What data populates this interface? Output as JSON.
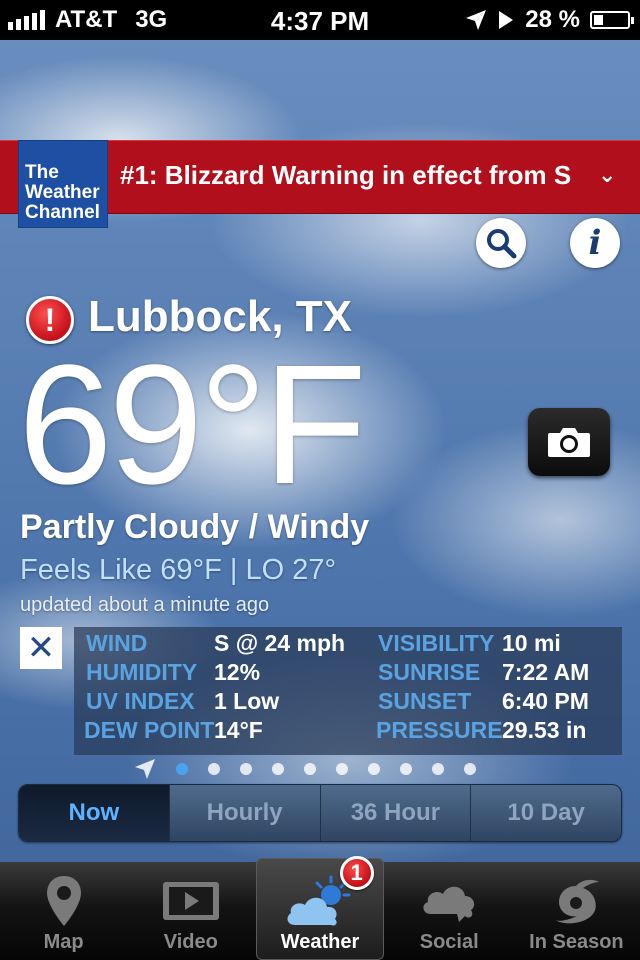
{
  "status_bar": {
    "carrier": "AT&T",
    "network": "3G",
    "time": "4:37 PM",
    "battery_percent": "28 %",
    "battery_level": 0.28
  },
  "brand": {
    "logo_lines": [
      "The",
      "Weather",
      "Channel"
    ]
  },
  "alert_banner": {
    "text": "#1: Blizzard Warning in effect from S",
    "chevron": "⌄"
  },
  "buttons": {
    "info_glyph": "i"
  },
  "current": {
    "alert_glyph": "!",
    "location": "Lubbock, TX",
    "temperature": "69°F",
    "condition": "Partly Cloudy / Windy",
    "feels_like": "Feels Like 69°F |  LO 27°",
    "updated": "updated about a minute ago"
  },
  "details": {
    "close_glyph": "✕",
    "rows": [
      {
        "l1": "WIND",
        "v1": "S @ 24 mph",
        "l2": "VISIBILITY",
        "v2": "10 mi"
      },
      {
        "l1": "HUMIDITY",
        "v1": "12%",
        "l2": "SUNRISE",
        "v2": "7:22 AM"
      },
      {
        "l1": "UV INDEX",
        "v1": "1 Low",
        "l2": "SUNSET",
        "v2": "6:40 PM"
      },
      {
        "l1": "DEW POINT",
        "v1": "14°F",
        "l2": "PRESSURE",
        "v2": "29.53 in"
      }
    ]
  },
  "pager": {
    "page_count": 10,
    "active_page": 1
  },
  "segmented": {
    "items": [
      "Now",
      "Hourly",
      "36 Hour",
      "10 Day"
    ],
    "active": "Now"
  },
  "tabbar": {
    "items": [
      {
        "label": "Map",
        "icon": "map-pin-icon"
      },
      {
        "label": "Video",
        "icon": "video-play-icon"
      },
      {
        "label": "Weather",
        "icon": "weather-cloud-sun-icon"
      },
      {
        "label": "Social",
        "icon": "social-cloud-icon"
      },
      {
        "label": "In Season",
        "icon": "hurricane-icon"
      }
    ],
    "active": "Weather",
    "weather_badge": "1"
  },
  "colors": {
    "banner_red": "#b10f1b",
    "twc_blue": "#1d4fa3",
    "detail_label": "#5aa3e0",
    "feels_like": "#bfe0ff",
    "active_segment_text": "#5fb2ff"
  }
}
